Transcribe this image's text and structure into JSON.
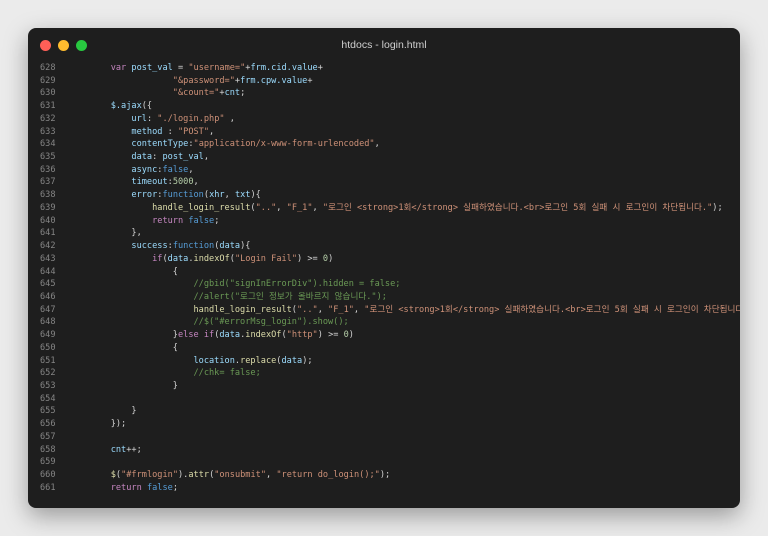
{
  "window": {
    "title": "htdocs - login.html",
    "controls": [
      {
        "name": "close",
        "color": "#ff5f57"
      },
      {
        "name": "minimize",
        "color": "#febc2e"
      },
      {
        "name": "maximize",
        "color": "#28c840"
      }
    ]
  },
  "editor": {
    "lines": [
      {
        "n": "628",
        "t": [
          [
            "pl",
            "    "
          ],
          [
            "kw",
            "var"
          ],
          [
            "pl",
            " "
          ],
          [
            "id",
            "post_val"
          ],
          [
            "pl",
            " = "
          ],
          [
            "st",
            "\"username=\""
          ],
          [
            "pl",
            "+"
          ],
          [
            "id",
            "frm.cid.value"
          ],
          [
            "pl",
            "+"
          ]
        ]
      },
      {
        "n": "629",
        "t": [
          [
            "pl",
            "                "
          ],
          [
            "st",
            "\"&password=\""
          ],
          [
            "pl",
            "+"
          ],
          [
            "id",
            "frm.cpw.value"
          ],
          [
            "pl",
            "+"
          ]
        ]
      },
      {
        "n": "630",
        "t": [
          [
            "pl",
            "                "
          ],
          [
            "st",
            "\"&count=\""
          ],
          [
            "pl",
            "+"
          ],
          [
            "id",
            "cnt"
          ],
          [
            "pl",
            ";"
          ]
        ]
      },
      {
        "n": "631",
        "t": [
          [
            "pl",
            "    "
          ],
          [
            "id",
            "$.ajax"
          ],
          [
            "pl",
            "({"
          ]
        ]
      },
      {
        "n": "632",
        "t": [
          [
            "pl",
            "        "
          ],
          [
            "id",
            "url"
          ],
          [
            "pl",
            ": "
          ],
          [
            "st",
            "\"./login.php\""
          ],
          [
            "pl",
            " ,"
          ]
        ]
      },
      {
        "n": "633",
        "t": [
          [
            "pl",
            "        "
          ],
          [
            "id",
            "method"
          ],
          [
            "pl",
            " : "
          ],
          [
            "st",
            "\"POST\""
          ],
          [
            "pl",
            ","
          ]
        ]
      },
      {
        "n": "634",
        "t": [
          [
            "pl",
            "        "
          ],
          [
            "id",
            "contentType"
          ],
          [
            "pl",
            ":"
          ],
          [
            "st",
            "\"application/x-www-form-urlencoded\""
          ],
          [
            "pl",
            ","
          ]
        ]
      },
      {
        "n": "635",
        "t": [
          [
            "pl",
            "        "
          ],
          [
            "id",
            "data"
          ],
          [
            "pl",
            ": "
          ],
          [
            "id",
            "post_val"
          ],
          [
            "pl",
            ","
          ]
        ]
      },
      {
        "n": "636",
        "t": [
          [
            "pl",
            "        "
          ],
          [
            "id",
            "async"
          ],
          [
            "pl",
            ":"
          ],
          [
            "bl",
            "false"
          ],
          [
            "pl",
            ","
          ]
        ]
      },
      {
        "n": "637",
        "t": [
          [
            "pl",
            "        "
          ],
          [
            "id",
            "timeout"
          ],
          [
            "pl",
            ":"
          ],
          [
            "nu",
            "5000"
          ],
          [
            "pl",
            ","
          ]
        ]
      },
      {
        "n": "638",
        "t": [
          [
            "pl",
            "        "
          ],
          [
            "id",
            "error"
          ],
          [
            "pl",
            ":"
          ],
          [
            "bl",
            "function"
          ],
          [
            "pl",
            "("
          ],
          [
            "id",
            "xhr"
          ],
          [
            "pl",
            ", "
          ],
          [
            "id",
            "txt"
          ],
          [
            "pl",
            "){"
          ]
        ]
      },
      {
        "n": "639",
        "t": [
          [
            "pl",
            "            "
          ],
          [
            "fn",
            "handle_login_result"
          ],
          [
            "pl",
            "("
          ],
          [
            "st",
            "\"..\""
          ],
          [
            "pl",
            ", "
          ],
          [
            "st",
            "\"F_1\""
          ],
          [
            "pl",
            ", "
          ],
          [
            "st",
            "\"로그인 <strong>1회</strong> 실패하였습니다.<br>로그인 5회 실패 시 로그인이 차단됩니다.\""
          ],
          [
            "pl",
            ");"
          ]
        ]
      },
      {
        "n": "640",
        "t": [
          [
            "pl",
            "            "
          ],
          [
            "kw",
            "return"
          ],
          [
            "pl",
            " "
          ],
          [
            "bl",
            "false"
          ],
          [
            "pl",
            ";"
          ]
        ]
      },
      {
        "n": "641",
        "t": [
          [
            "pl",
            "        },"
          ]
        ]
      },
      {
        "n": "642",
        "t": [
          [
            "pl",
            "        "
          ],
          [
            "id",
            "success"
          ],
          [
            "pl",
            ":"
          ],
          [
            "bl",
            "function"
          ],
          [
            "pl",
            "("
          ],
          [
            "id",
            "data"
          ],
          [
            "pl",
            "){"
          ]
        ]
      },
      {
        "n": "643",
        "t": [
          [
            "pl",
            "            "
          ],
          [
            "kw",
            "if"
          ],
          [
            "pl",
            "("
          ],
          [
            "id",
            "data"
          ],
          [
            "pl",
            "."
          ],
          [
            "fn",
            "indexOf"
          ],
          [
            "pl",
            "("
          ],
          [
            "st",
            "\"Login Fail\""
          ],
          [
            "pl",
            ") >= "
          ],
          [
            "nu",
            "0"
          ],
          [
            "pl",
            ")"
          ]
        ]
      },
      {
        "n": "644",
        "t": [
          [
            "pl",
            "                {"
          ]
        ]
      },
      {
        "n": "645",
        "t": [
          [
            "pl",
            "                    "
          ],
          [
            "cm",
            "//gbid(\"signInErrorDiv\").hidden = false;"
          ]
        ]
      },
      {
        "n": "646",
        "t": [
          [
            "pl",
            "                    "
          ],
          [
            "cm",
            "//alert(\"로그인 정보가 올바르지 않습니다.\");"
          ]
        ]
      },
      {
        "n": "647",
        "t": [
          [
            "pl",
            "                    "
          ],
          [
            "fn",
            "handle_login_result"
          ],
          [
            "pl",
            "("
          ],
          [
            "st",
            "\"..\""
          ],
          [
            "pl",
            ", "
          ],
          [
            "st",
            "\"F_1\""
          ],
          [
            "pl",
            ", "
          ],
          [
            "st",
            "\"로그인 <strong>1회</strong> 실패하였습니다.<br>로그인 5회 실패 시 로그인이 차단됩니다.\""
          ],
          [
            "pl",
            ");"
          ]
        ]
      },
      {
        "n": "648",
        "t": [
          [
            "pl",
            "                    "
          ],
          [
            "cm",
            "//$(\"#errorMsg_login\").show();"
          ]
        ]
      },
      {
        "n": "649",
        "t": [
          [
            "pl",
            "                }"
          ],
          [
            "kw",
            "else if"
          ],
          [
            "pl",
            "("
          ],
          [
            "id",
            "data"
          ],
          [
            "pl",
            "."
          ],
          [
            "fn",
            "indexOf"
          ],
          [
            "pl",
            "("
          ],
          [
            "st",
            "\"http\""
          ],
          [
            "pl",
            ") >= "
          ],
          [
            "nu",
            "0"
          ],
          [
            "pl",
            ")"
          ]
        ]
      },
      {
        "n": "650",
        "t": [
          [
            "pl",
            "                {"
          ]
        ]
      },
      {
        "n": "651",
        "t": [
          [
            "pl",
            "                    "
          ],
          [
            "id",
            "location"
          ],
          [
            "pl",
            "."
          ],
          [
            "fn",
            "replace"
          ],
          [
            "pl",
            "("
          ],
          [
            "id",
            "data"
          ],
          [
            "pl",
            ");"
          ]
        ]
      },
      {
        "n": "652",
        "t": [
          [
            "pl",
            "                    "
          ],
          [
            "cm",
            "//chk= false;"
          ]
        ]
      },
      {
        "n": "653",
        "t": [
          [
            "pl",
            "                }"
          ]
        ]
      },
      {
        "n": "654",
        "t": []
      },
      {
        "n": "655",
        "t": [
          [
            "pl",
            "        }"
          ]
        ]
      },
      {
        "n": "656",
        "t": [
          [
            "pl",
            "    });"
          ]
        ]
      },
      {
        "n": "657",
        "t": []
      },
      {
        "n": "658",
        "t": [
          [
            "pl",
            "    "
          ],
          [
            "id",
            "cnt"
          ],
          [
            "pl",
            "++;"
          ]
        ]
      },
      {
        "n": "659",
        "t": []
      },
      {
        "n": "660",
        "t": [
          [
            "pl",
            "    "
          ],
          [
            "fn",
            "$"
          ],
          [
            "pl",
            "("
          ],
          [
            "st",
            "\"#frmlogin\""
          ],
          [
            "pl",
            ")."
          ],
          [
            "fn",
            "attr"
          ],
          [
            "pl",
            "("
          ],
          [
            "st",
            "\"onsubmit\""
          ],
          [
            "pl",
            ", "
          ],
          [
            "st",
            "\"return do_login();\""
          ],
          [
            "pl",
            ");"
          ]
        ]
      },
      {
        "n": "661",
        "t": [
          [
            "pl",
            "    "
          ],
          [
            "kw",
            "return"
          ],
          [
            "pl",
            " "
          ],
          [
            "bl",
            "false"
          ],
          [
            "pl",
            ";"
          ]
        ]
      }
    ]
  }
}
